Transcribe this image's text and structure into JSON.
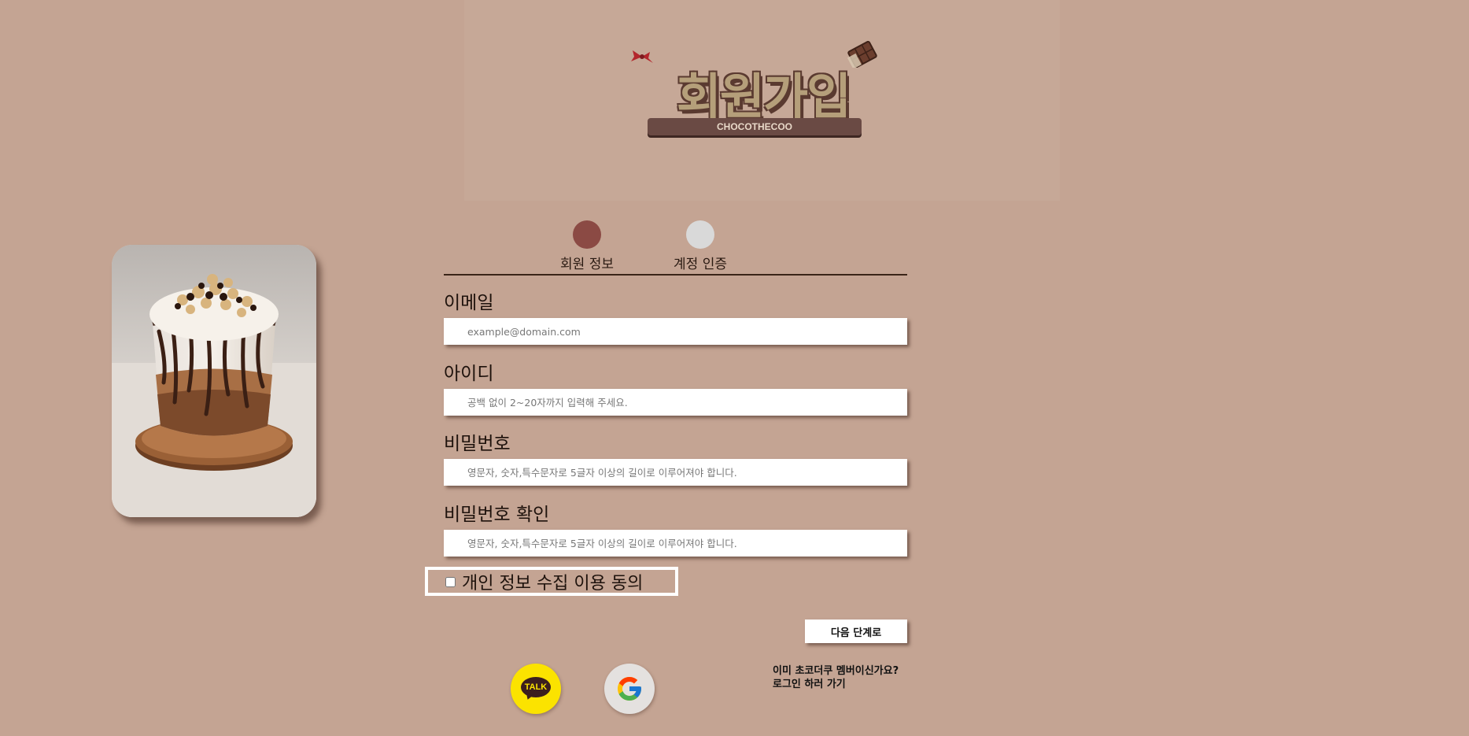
{
  "logo": {
    "title": "회원가입",
    "subtitle": "CHOCOTHECOO"
  },
  "steps": [
    {
      "label": "회원 정보",
      "color": "#8b4a44",
      "active": true
    },
    {
      "label": "계정 인증",
      "color": "#d9d9d9",
      "active": false
    }
  ],
  "form": {
    "email": {
      "label": "이메일",
      "placeholder": "example@domain.com"
    },
    "user_id": {
      "label": "아이디",
      "placeholder": "공백 없이 2~20자까지 입력해 주세요."
    },
    "password": {
      "label": "비밀번호",
      "placeholder": "영문자, 숫자,특수문자로 5글자 이상의 길이로 이루어져야 합니다."
    },
    "password_confirm": {
      "label": "비밀번호 확인",
      "placeholder": "영문자, 숫자,특수문자로 5글자 이상의 길이로 이루어져야 합니다."
    },
    "agree_label": "개인 정보 수집 이용 동의",
    "agree_checked": false,
    "next_label": "다음 단계로"
  },
  "social": {
    "kakao_label": "TALK",
    "kakao_icon": "kakao-talk-icon",
    "google_icon": "google-g-icon"
  },
  "login_link": {
    "line1": "이미 초코더쿠 멤버이신가요?",
    "line2": "로그인 하러 가기"
  },
  "colors": {
    "background": "#c4a493",
    "accent": "#8b4a44",
    "kakao": "#fbe300"
  }
}
